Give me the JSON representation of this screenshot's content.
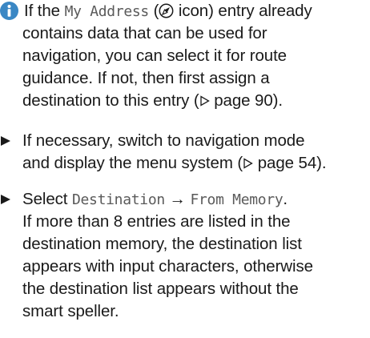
{
  "info_note": {
    "l1_pre": "If the ",
    "l1_mono": "My Address",
    "l1_open": " (",
    "l1_post": " icon) entry already",
    "l2": "contains data that can be used for",
    "l3": "navigation, you can select it for route",
    "l4": "guidance. If not, then first assign a",
    "l5_pre": "destination to this entry (",
    "l5_ref": " page 90)."
  },
  "step1": {
    "l1": "If necessary, switch to navigation mode",
    "l2_pre": "and display the menu system (",
    "l2_ref": " page 54)."
  },
  "step2": {
    "l1_pre": "Select ",
    "l1_mono1": "Destination",
    "l1_arrow": " → ",
    "l1_mono2": "From Memory",
    "l1_post": ".",
    "l2": "If more than 8 entries are listed in the",
    "l3": "destination memory, the destination list",
    "l4": "appears with input characters, otherwise",
    "l5": "the destination list appears without the",
    "l6": "smart speller."
  },
  "colors": {
    "info_blue": "#3a87c4",
    "text": "#1a1a1a",
    "mono": "#5a5a5a"
  },
  "icons": [
    "info-icon",
    "navigation-icon",
    "triangle-arrow-icon"
  ]
}
